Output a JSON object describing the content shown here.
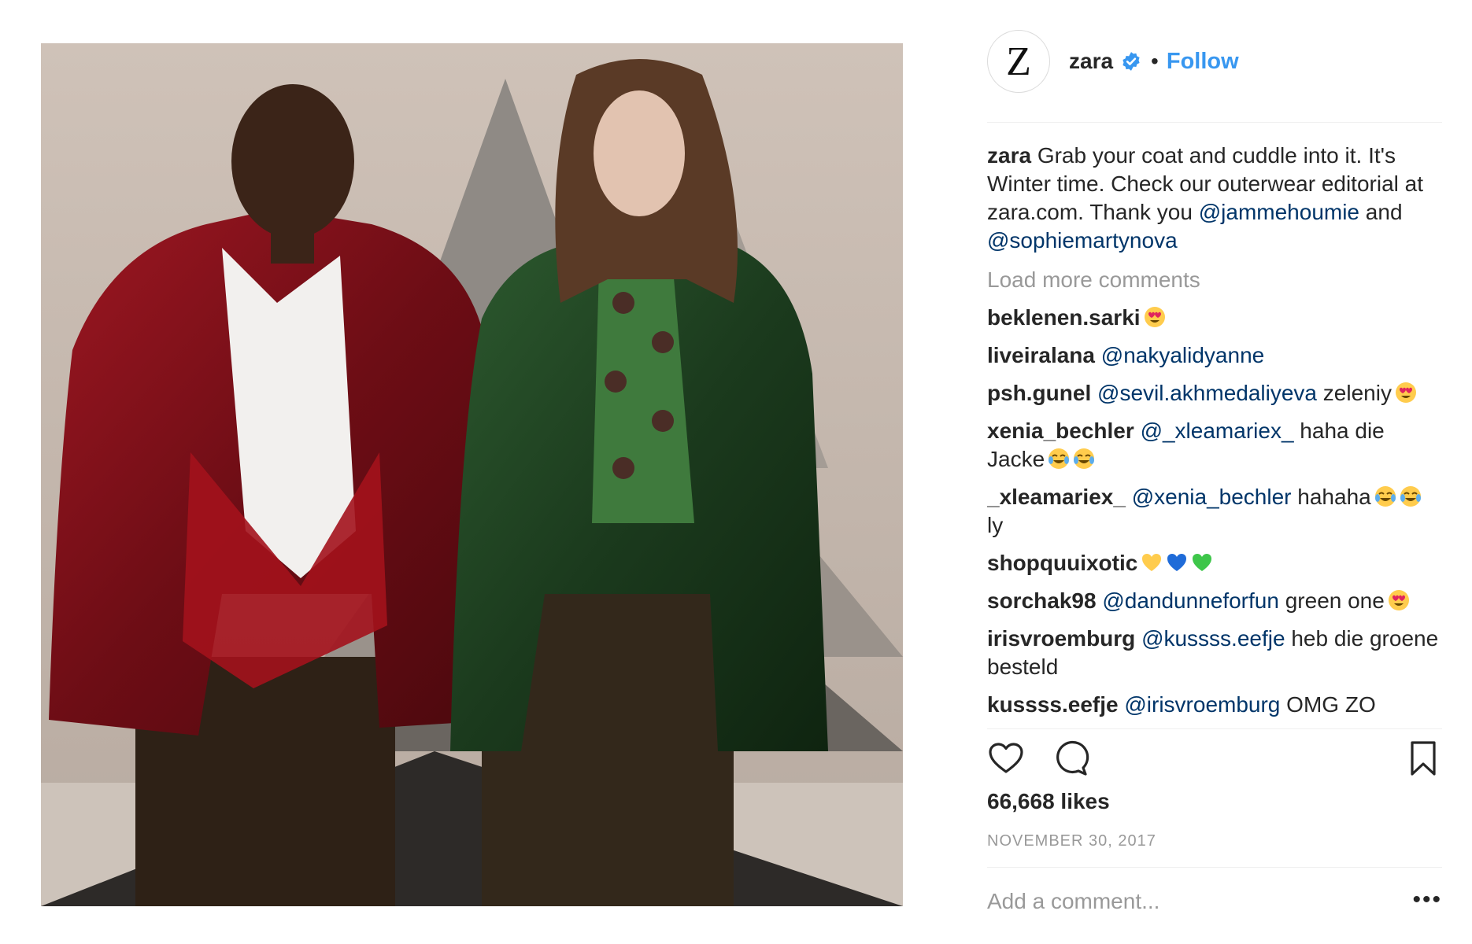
{
  "post": {
    "username": "zara",
    "avatar_letter": "Z",
    "follow_label": "Follow",
    "dot": "•",
    "caption": {
      "user": "zara",
      "text": "Grab your coat and cuddle into it. It's Winter time. Check our outerwear editorial at zara.com. Thank you",
      "mention1": "@jammehoumie",
      "and": "and",
      "mention2": "@sophiemartynova"
    },
    "load_more": "Load more comments",
    "comments": [
      {
        "user": "beklenen.sarki",
        "mention": "",
        "text": "",
        "emoji": [
          "heart-eyes"
        ]
      },
      {
        "user": "liveiralana",
        "mention": "@nakyalidyanne",
        "text": "",
        "emoji": []
      },
      {
        "user": "psh.gunel",
        "mention": "@sevil.akhmedaliyeva",
        "text": "zeleniy",
        "emoji": [
          "heart-eyes"
        ]
      },
      {
        "user": "xenia_bechler",
        "mention": "@_xleamariex_",
        "text": "haha die Jacke",
        "emoji": [
          "tears-of-joy",
          "tears-of-joy"
        ]
      },
      {
        "user": "_xleamariex_",
        "mention": "@xenia_bechler",
        "text": "hahaha",
        "emoji": [
          "tears-of-joy",
          "tears-of-joy"
        ],
        "tail": "ly"
      },
      {
        "user": "shopquuixotic",
        "mention": "",
        "text": "",
        "emoji": [
          "yellow-heart",
          "blue-heart",
          "green-heart"
        ]
      },
      {
        "user": "sorchak98",
        "mention": "@dandunneforfun",
        "text": "green one",
        "emoji": [
          "heart-eyes"
        ]
      },
      {
        "user": "irisvroemburg",
        "mention": "@kussss.eefje",
        "text": "heb die groene besteld",
        "emoji": []
      },
      {
        "user": "kussss.eefje",
        "mention": "@irisvroemburg",
        "text": "OMG ZO",
        "emoji": []
      }
    ],
    "likes": "66,668 likes",
    "date": "NOVEMBER 30, 2017",
    "add_comment_placeholder": "Add a comment...",
    "more_label": "•••"
  },
  "icons": {
    "verified": "verified-badge-icon",
    "like": "heart-icon",
    "comment": "comment-icon",
    "save": "bookmark-icon",
    "more": "more-options-icon"
  },
  "colors": {
    "link": "#3897f0",
    "mention": "#003569",
    "muted": "#999999",
    "text": "#262626",
    "divider": "#efefef"
  }
}
